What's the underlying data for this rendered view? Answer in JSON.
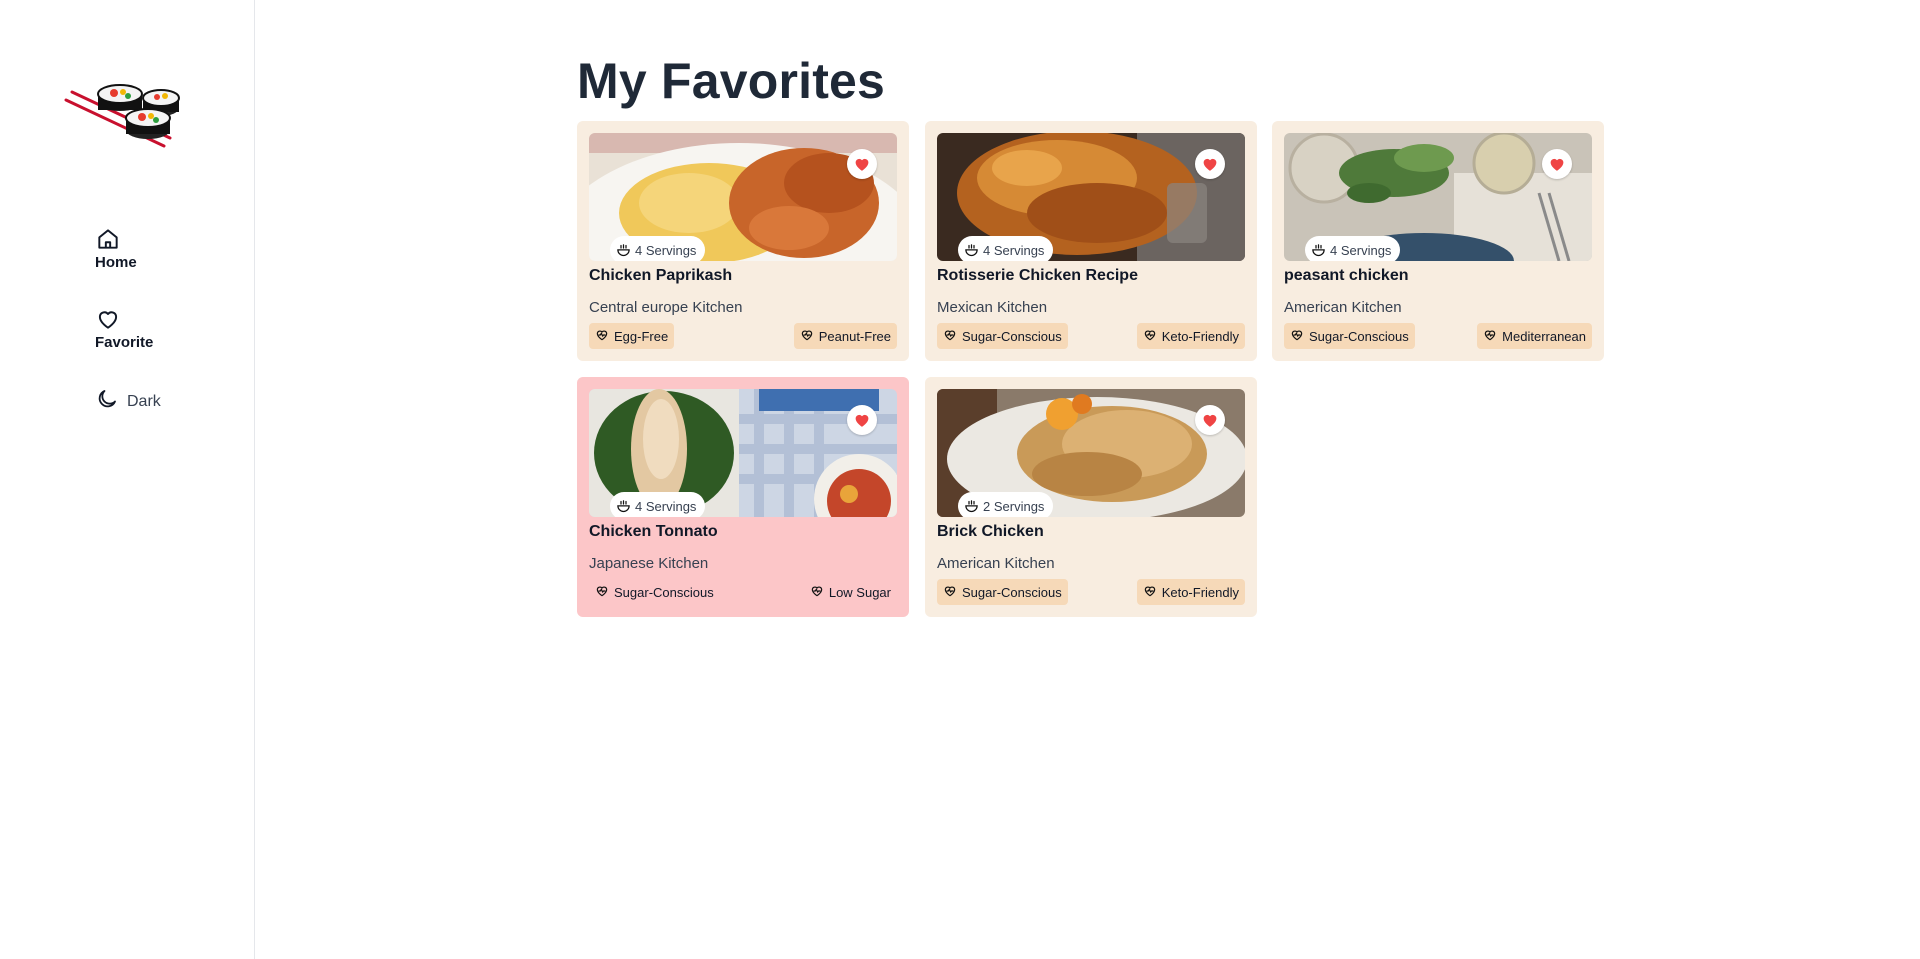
{
  "sidebar": {
    "logo_icon": "sushi-logo",
    "nav": [
      {
        "label": "Home",
        "icon": "home-icon"
      },
      {
        "label": "Favorite",
        "icon": "heart-icon"
      },
      {
        "label": "Dark",
        "icon": "moon-icon"
      }
    ]
  },
  "main": {
    "title": "My Favorites",
    "cards": [
      {
        "title": "Chicken Paprikash",
        "kitchen": "Central europe Kitchen",
        "servings": "4 Servings",
        "tags": [
          "Egg-Free",
          "Peanut-Free"
        ],
        "favorited": true,
        "highlighted": false
      },
      {
        "title": "Rotisserie Chicken Recipe",
        "kitchen": "Mexican Kitchen",
        "servings": "4 Servings",
        "tags": [
          "Sugar-Conscious",
          "Keto-Friendly"
        ],
        "favorited": true,
        "highlighted": false
      },
      {
        "title": "peasant chicken",
        "kitchen": "American Kitchen",
        "servings": "4 Servings",
        "tags": [
          "Sugar-Conscious",
          "Mediterranean"
        ],
        "favorited": true,
        "highlighted": false
      },
      {
        "title": "Chicken Tonnato",
        "kitchen": "Japanese Kitchen",
        "servings": "4 Servings",
        "tags": [
          "Sugar-Conscious",
          "Low Sugar"
        ],
        "favorited": true,
        "highlighted": true
      },
      {
        "title": "Brick Chicken",
        "kitchen": "American Kitchen",
        "servings": "2 Servings",
        "tags": [
          "Sugar-Conscious",
          "Keto-Friendly"
        ],
        "favorited": true,
        "highlighted": false
      }
    ]
  },
  "colors": {
    "card_bg": "#f8ede0",
    "card_highlight_bg": "#fcc6c8",
    "tag_bg": "#f6d9b8",
    "heart": "#ef4444",
    "title_text": "#1f2937"
  }
}
